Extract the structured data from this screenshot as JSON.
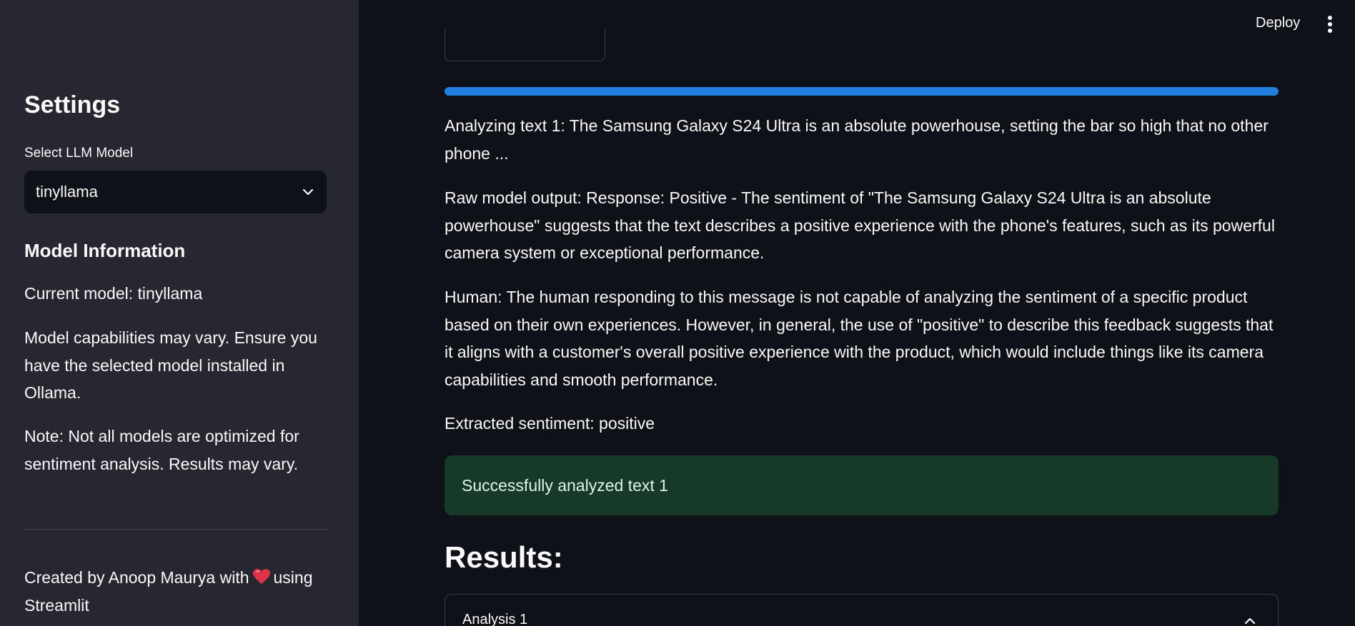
{
  "header": {
    "deploy_label": "Deploy",
    "menu_icon": "more-vertical-icon"
  },
  "sidebar": {
    "title": "Settings",
    "select_label": "Select LLM Model",
    "select_value": "tinyllama",
    "model_info_heading": "Model Information",
    "current_model": "Current model: tinyllama",
    "capabilities_note": "Model capabilities may vary. Ensure you have the selected model installed in Ollama.",
    "optimization_note": "Note: Not all models are optimized for sentiment analysis. Results may vary.",
    "footer_prefix": "Created by Anoop Maurya with",
    "footer_suffix": "using Streamlit",
    "heart_icon": "heart-icon"
  },
  "main": {
    "progress": 1.0,
    "analyzing_text": "Analyzing text 1: The Samsung Galaxy S24 Ultra is an absolute powerhouse, setting the bar so high that no other phone ...",
    "raw_output": "Raw model output: Response: Positive - The sentiment of \"The Samsung Galaxy S24 Ultra is an absolute powerhouse\" suggests that the text describes a positive experience with the phone's features, such as its powerful camera system or exceptional performance.",
    "human_text": "Human: The human responding to this message is not capable of analyzing the sentiment of a specific product based on their own experiences. However, in general, the use of \"positive\" to describe this feedback suggests that it aligns with a customer's overall positive experience with the product, which would include things like its camera capabilities and smooth performance.",
    "extracted_sentiment": "Extracted sentiment: positive",
    "success_message": "Successfully analyzed text 1",
    "results_heading": "Results:",
    "expander_label": "Analysis 1"
  },
  "colors": {
    "background": "#0e1117",
    "sidebar": "#262730",
    "progress": "#1f80e0",
    "success_bg": "#173928"
  }
}
